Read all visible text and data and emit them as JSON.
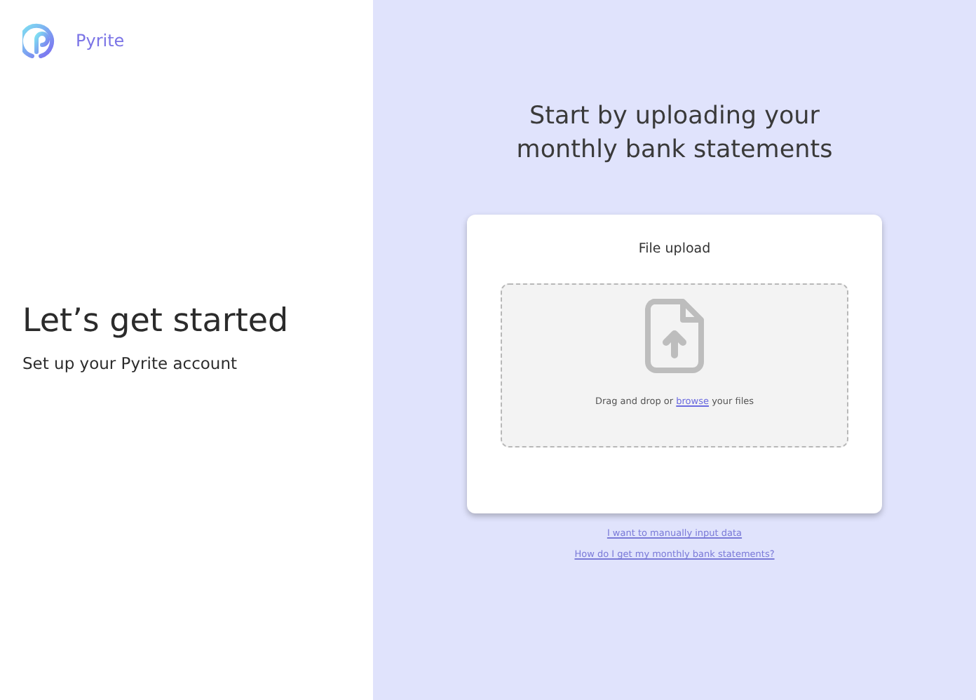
{
  "brand": {
    "name": "Pyrite"
  },
  "intro": {
    "title": "Let’s get started",
    "subtitle": "Set up your Pyrite account"
  },
  "heading": "Start by uploading your monthly bank statements",
  "upload_card": {
    "title": "File upload",
    "dropzone": {
      "text_before": "Drag and drop or",
      "link": "browse",
      "text_after": "your files"
    }
  },
  "links": [
    "I want to manually input data",
    "How do I get my monthly bank statements?"
  ]
}
